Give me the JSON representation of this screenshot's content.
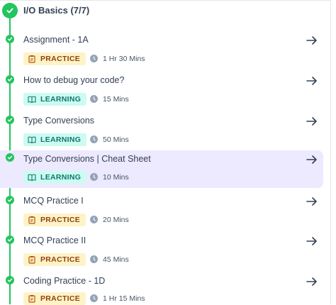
{
  "section": {
    "title": "I/O Basics (7/7)"
  },
  "items": [
    {
      "title": "Assignment - 1A",
      "type": "PRACTICE",
      "duration": "1 Hr 30 Mins"
    },
    {
      "title": "How to debug your code?",
      "type": "LEARNING",
      "duration": "15 Mins"
    },
    {
      "title": "Type Conversions",
      "type": "LEARNING",
      "duration": "50 Mins"
    },
    {
      "title": "Type Conversions | Cheat Sheet",
      "type": "LEARNING",
      "duration": "10 Mins",
      "active": true
    },
    {
      "title": "MCQ Practice I",
      "type": "PRACTICE",
      "duration": "20 Mins"
    },
    {
      "title": "MCQ Practice II",
      "type": "PRACTICE",
      "duration": "45 Mins"
    },
    {
      "title": "Coding Practice - 1D",
      "type": "PRACTICE",
      "duration": "1 Hr 15 Mins"
    }
  ],
  "colors": {
    "completed": "#22c55e",
    "practice_bg": "#fef3c7",
    "practice_text": "#92400e",
    "learning_bg": "#ccfbf1",
    "learning_text": "#0f766e",
    "active_bg": "#ede9fe"
  },
  "icons": {
    "completed": "check-circle-icon",
    "practice": "clipboard-icon",
    "learning": "book-icon",
    "duration": "clock-icon",
    "open": "arrow-right-icon"
  }
}
